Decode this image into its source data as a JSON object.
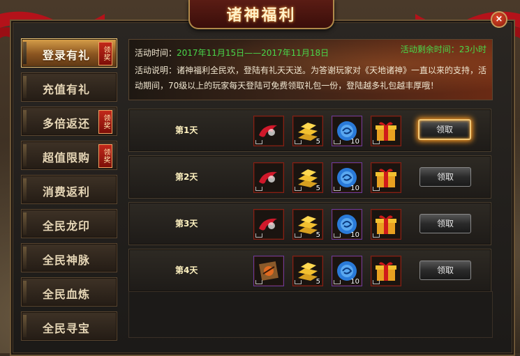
{
  "window": {
    "title": "诸神福利",
    "close_label": "×"
  },
  "sidebar": {
    "items": [
      {
        "label": "登录有礼",
        "badge": "领奖",
        "active": true
      },
      {
        "label": "充值有礼",
        "badge": ""
      },
      {
        "label": "多倍返还",
        "badge": "领奖"
      },
      {
        "label": "超值限购",
        "badge": "领奖"
      },
      {
        "label": "消费返利",
        "badge": ""
      },
      {
        "label": "全民龙印",
        "badge": ""
      },
      {
        "label": "全民神脉",
        "badge": ""
      },
      {
        "label": "全民血炼",
        "badge": ""
      },
      {
        "label": "全民寻宝",
        "badge": ""
      }
    ]
  },
  "info": {
    "time_label": "活动时间：",
    "time_value": "2017年11月15日——2017年11月18日",
    "remaining": "活动剩余时间：23小时",
    "desc": "活动说明：诸神福利全民欢，登陆有礼天天送。为答谢玩家对《天地诸神》一直以来的支持，活动期间，70级以上的玩家每天登陆可免费领取礼包一份，登陆越多礼包越丰厚哦！"
  },
  "rows": [
    {
      "day": "第1天",
      "claim": "领取",
      "items": [
        {
          "icon": "red-wing-icon",
          "count": ""
        },
        {
          "icon": "gold-bars-icon",
          "count": "5"
        },
        {
          "icon": "blue-orb-icon",
          "count": "10"
        },
        {
          "icon": "gift-box-icon",
          "count": ""
        }
      ]
    },
    {
      "day": "第2天",
      "claim": "领取",
      "items": [
        {
          "icon": "red-wing-icon",
          "count": ""
        },
        {
          "icon": "gold-bars-icon",
          "count": "5"
        },
        {
          "icon": "blue-orb-icon",
          "count": "10"
        },
        {
          "icon": "gift-box-icon",
          "count": ""
        }
      ]
    },
    {
      "day": "第3天",
      "claim": "领取",
      "items": [
        {
          "icon": "red-wing-icon",
          "count": ""
        },
        {
          "icon": "gold-bars-icon",
          "count": "5"
        },
        {
          "icon": "blue-orb-icon",
          "count": "10"
        },
        {
          "icon": "gift-box-icon",
          "count": ""
        }
      ]
    },
    {
      "day": "第4天",
      "claim": "领取",
      "items": [
        {
          "icon": "scroll-icon",
          "count": ""
        },
        {
          "icon": "gold-bars-icon",
          "count": "5"
        },
        {
          "icon": "blue-orb-icon",
          "count": "10"
        },
        {
          "icon": "gift-box-icon",
          "count": ""
        }
      ]
    }
  ],
  "colors": {
    "accent_green": "#4ad84a",
    "active_tab": "#c8883a",
    "badge_red": "#c2281a"
  }
}
